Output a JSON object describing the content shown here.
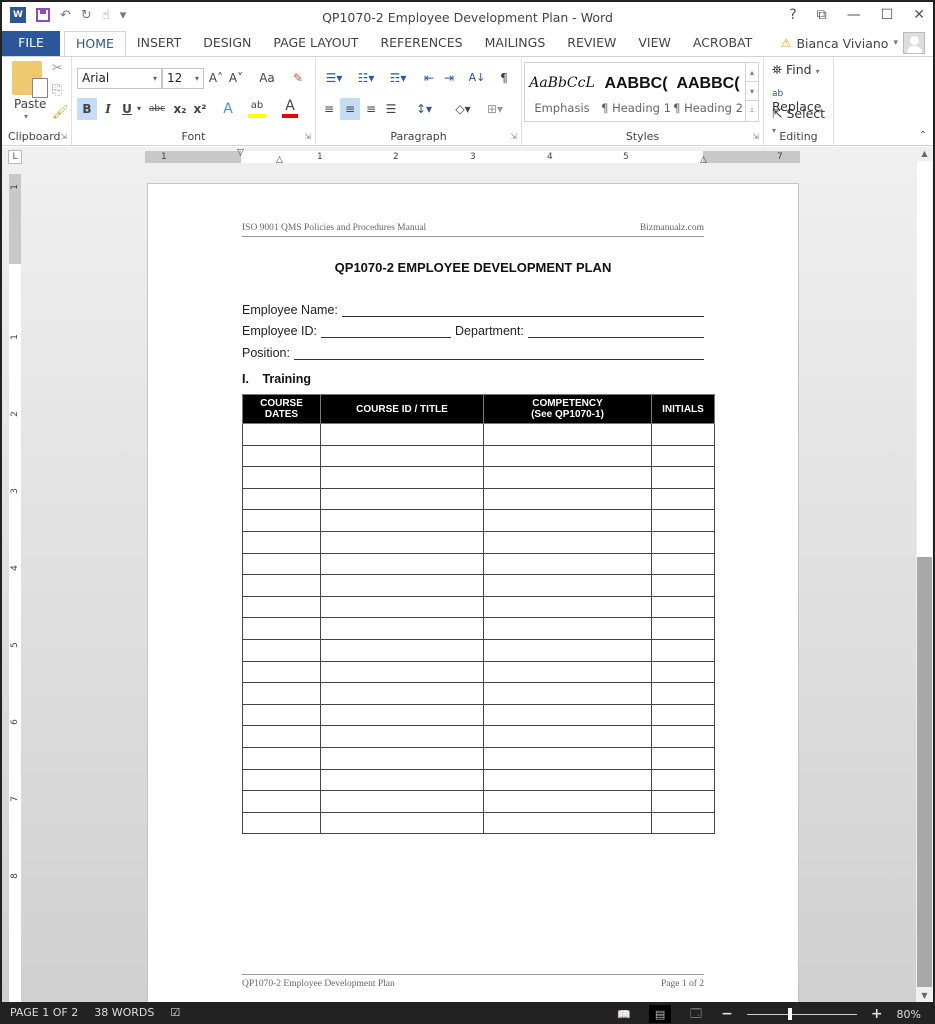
{
  "window": {
    "title": "QP1070-2 Employee Development Plan - Word",
    "controls": {
      "help": "?",
      "ribbon_display": "⧉",
      "minimize": "—",
      "maximize": "☐",
      "close": "✕"
    }
  },
  "quick_access": {
    "app_icon": "W",
    "undo": "↶",
    "redo": "↻",
    "touch": "☝",
    "customize": "▾"
  },
  "tabs": [
    {
      "label": "FILE"
    },
    {
      "label": "HOME"
    },
    {
      "label": "INSERT"
    },
    {
      "label": "DESIGN"
    },
    {
      "label": "PAGE LAYOUT"
    },
    {
      "label": "REFERENCES"
    },
    {
      "label": "MAILINGS"
    },
    {
      "label": "REVIEW"
    },
    {
      "label": "VIEW"
    },
    {
      "label": "ACROBAT"
    }
  ],
  "user": {
    "warning": "⚠",
    "name": "Bianca Viviano",
    "caret": "▾"
  },
  "ribbon": {
    "clipboard": {
      "label": "Clipboard",
      "paste": "Paste"
    },
    "font": {
      "label": "Font",
      "font_name": "Arial",
      "font_size": "12",
      "grow": "A˄",
      "shrink": "A˅",
      "change_case": "Aa",
      "bold": "B",
      "italic": "I",
      "underline": "U",
      "strike": "abc",
      "subscript": "x₂",
      "superscript": "x²",
      "text_effects": "A",
      "highlight": "ab",
      "font_color": "A"
    },
    "paragraph": {
      "label": "Paragraph",
      "pilcrow": "¶",
      "sort": "A↓"
    },
    "styles": {
      "label": "Styles",
      "items": [
        {
          "sample": "AaBbCcL",
          "name": "Emphasis"
        },
        {
          "sample": "AABBC(",
          "name": "¶ Heading 1"
        },
        {
          "sample": "AABBC(",
          "name": "¶ Heading 2"
        }
      ]
    },
    "editing": {
      "label": "Editing",
      "find": "Find",
      "replace": "Replace",
      "select": "Select"
    }
  },
  "ruler": {
    "tab_selector": "L",
    "numbers": [
      "1",
      "1",
      "2",
      "3",
      "4",
      "5",
      "7"
    ],
    "vertical_numbers": [
      "1",
      "1",
      "2",
      "3",
      "4",
      "5",
      "6",
      "7",
      "8"
    ]
  },
  "document": {
    "header_left": "ISO 9001 QMS Policies and Procedures Manual",
    "header_right": "Bizmanualz.com",
    "title": "QP1070-2 EMPLOYEE DEVELOPMENT PLAN",
    "fields": {
      "employee_name": "Employee Name:",
      "employee_id": "Employee ID:",
      "department": "Department:",
      "position": "Position:"
    },
    "section_number": "I.",
    "section_title": "Training",
    "table": {
      "headers": [
        "COURSE\nDATES",
        "COURSE ID / TITLE",
        "COMPETENCY\n(See QP1070-1)",
        "INITIALS"
      ],
      "header_lines": [
        [
          "COURSE",
          "DATES"
        ],
        [
          "COURSE ID / TITLE"
        ],
        [
          "COMPETENCY",
          "(See QP1070-1)"
        ],
        [
          "INITIALS"
        ]
      ],
      "empty_rows": 19
    },
    "footer_left": "QP1070-2 Employee Development Plan",
    "footer_right": "Page 1 of 2"
  },
  "status": {
    "page": "PAGE 1 OF 2",
    "words": "38 WORDS",
    "proofing_icon": "☑",
    "zoom_minus": "−",
    "zoom_plus": "+",
    "zoom_level": "80%",
    "zoom_percent": 80
  },
  "scroll": {
    "position_fraction": 0.0,
    "visible_fraction": 0.47
  }
}
